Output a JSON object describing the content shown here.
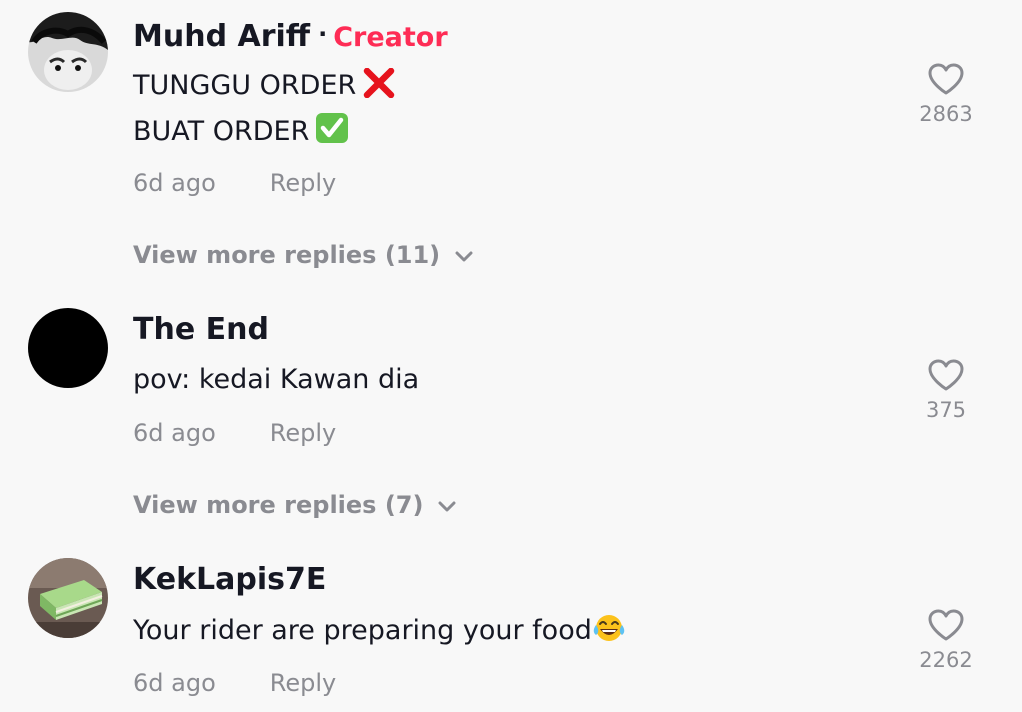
{
  "comments": [
    {
      "username": "Muhd Ariff",
      "separator": "·",
      "badge": "Creator",
      "lines": [
        "TUNGGU ORDER",
        "BUAT ORDER"
      ],
      "line_icons": [
        "cross-mark-emoji",
        "check-mark-emoji"
      ],
      "time": "6d ago",
      "reply_label": "Reply",
      "view_more": "View more replies (11)",
      "likes": "2863"
    },
    {
      "username": "The End",
      "lines": [
        "pov: kedai Kawan dia"
      ],
      "time": "6d ago",
      "reply_label": "Reply",
      "view_more": "View more replies (7)",
      "likes": "375"
    },
    {
      "username": "KekLapis7E",
      "lines": [
        "Your rider are preparing your food"
      ],
      "line_icons": [
        "tears-of-joy-emoji"
      ],
      "time": "6d ago",
      "reply_label": "Reply",
      "likes": "2262"
    }
  ],
  "colors": {
    "background": "#f8f8f8",
    "text": "#161823",
    "secondary": "#8a8b91",
    "creator_badge": "#fe2c55"
  }
}
